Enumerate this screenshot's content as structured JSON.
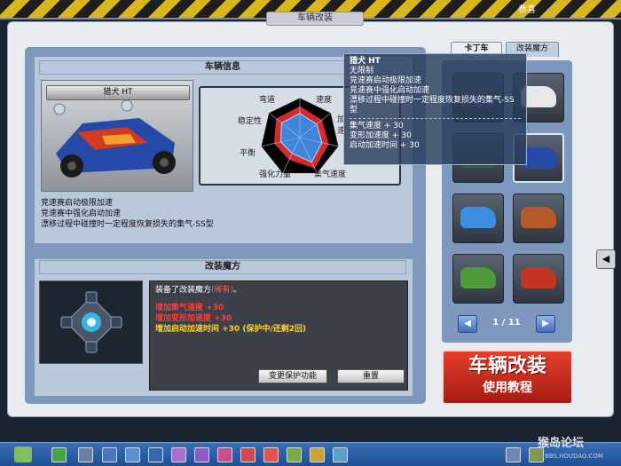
{
  "window_title": "车辆改装",
  "congrats": "恭喜",
  "vehicle_info": {
    "header": "车辆信息",
    "car_name": "猎犬 HT",
    "stats": [
      "弯道",
      "速度",
      "加速",
      "集气速度",
      "强化力量",
      "平衡",
      "稳定性"
    ],
    "description": [
      "竞速赛启动极限加速",
      "竞速赛中强化启动加速",
      "漂移过程中碰撞时一定程度恢复损失的集气-SS型"
    ]
  },
  "mod_magic": {
    "header": "改装魔方",
    "equipped_prefix": "装备了改装魔方",
    "equipped_name": "(稀有)",
    "equipped_suffix": "。",
    "lines": [
      {
        "text": "增加集气速度 +30",
        "color": "#ff3b3b"
      },
      {
        "text": "增加变形加速度 +30",
        "color": "#ff3b3b"
      },
      {
        "text": "增加启动加速时间 +30 (保护中/还剩2回)",
        "color": "#ffd21f"
      }
    ],
    "change_protect_button": "变更保护功能",
    "reset_button": "重置"
  },
  "tabs": [
    "卡丁车",
    "改装魔方"
  ],
  "pagination": {
    "current": 1,
    "total": 11
  },
  "tutorial": {
    "line1": "车辆改装",
    "line2": "使用教程"
  },
  "tooltip": {
    "title": "猎犬 HT",
    "lines": [
      "无限制",
      "竞速赛启动极限加速",
      "竞速赛中强化启动加速",
      "漂移过程中碰撞时一定程度恢复损失的集气-SS型"
    ],
    "bonuses": [
      "集气速度 + 30",
      "变形加速度 + 30",
      "启动加速时间 + 30"
    ]
  },
  "watermark": {
    "text": "猴岛论坛",
    "url": "BBS.HOUDAO.COM"
  },
  "colors": {
    "accent": "#2b5fa8",
    "rare": "#ff5a5a"
  },
  "radar_values": [
    0.62,
    0.55,
    0.58,
    0.7,
    0.45,
    0.5,
    0.6
  ]
}
